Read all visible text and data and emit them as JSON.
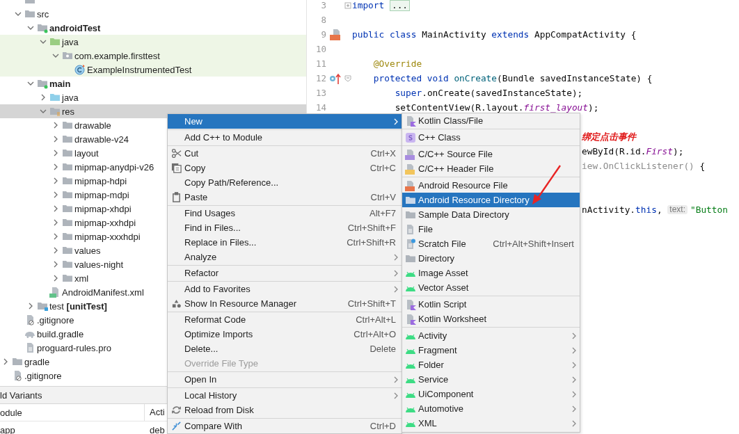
{
  "tree": {
    "items": [
      {
        "children": [
          {
            "kind": "folder",
            "selected": false,
            "highlighted": false
          },
          {
            "label": "src",
            "kind": "folder",
            "expanded": true,
            "selected": false,
            "highlighted": false,
            "children": [
              {
                "label": "androidTest",
                "kind": "module-folder",
                "expanded": true,
                "selected": false,
                "highlighted": false,
                "children": [
                  {
                    "label": "java",
                    "kind": "test-source",
                    "expanded": true,
                    "selected": false,
                    "highlighted": true,
                    "children": [
                      {
                        "label": "com.example.firsttest",
                        "kind": "package",
                        "expanded": true,
                        "selected": false,
                        "highlighted": true,
                        "children": [
                          {
                            "label": "ExampleInstrumentedTest",
                            "kind": "test-class",
                            "selected": false,
                            "highlighted": true
                          }
                        ]
                      }
                    ]
                  }
                ]
              },
              {
                "label": "main",
                "kind": "module-folder",
                "expanded": true,
                "selected": false,
                "highlighted": false,
                "children": [
                  {
                    "label": "java",
                    "kind": "source-folder",
                    "expanded": false,
                    "selected": false,
                    "highlighted": false
                  },
                  {
                    "label": "res",
                    "kind": "resource-folder",
                    "expanded": true,
                    "selected": true,
                    "highlighted": false,
                    "children": [
                      {
                        "label": "drawable",
                        "kind": "folder",
                        "expanded": false,
                        "selected": false,
                        "highlighted": false
                      },
                      {
                        "label": "drawable-v24",
                        "kind": "folder",
                        "expanded": false,
                        "selected": false,
                        "highlighted": false
                      },
                      {
                        "label": "layout",
                        "kind": "folder",
                        "expanded": false,
                        "selected": false,
                        "highlighted": false
                      },
                      {
                        "label": "mipmap-anydpi-v26",
                        "kind": "folder",
                        "expanded": false,
                        "selected": false,
                        "highlighted": false
                      },
                      {
                        "label": "mipmap-hdpi",
                        "kind": "folder",
                        "expanded": false,
                        "selected": false,
                        "highlighted": false
                      },
                      {
                        "label": "mipmap-mdpi",
                        "kind": "folder",
                        "expanded": false,
                        "selected": false,
                        "highlighted": false
                      },
                      {
                        "label": "mipmap-xhdpi",
                        "kind": "folder",
                        "expanded": false,
                        "selected": false,
                        "highlighted": false
                      },
                      {
                        "label": "mipmap-xxhdpi",
                        "kind": "folder",
                        "expanded": false,
                        "selected": false,
                        "highlighted": false
                      },
                      {
                        "label": "mipmap-xxxhdpi",
                        "kind": "folder",
                        "expanded": false,
                        "selected": false,
                        "highlighted": false
                      },
                      {
                        "label": "values",
                        "kind": "folder",
                        "expanded": false,
                        "selected": false,
                        "highlighted": false
                      },
                      {
                        "label": "values-night",
                        "kind": "folder",
                        "expanded": false,
                        "selected": false,
                        "highlighted": false
                      },
                      {
                        "label": "xml",
                        "kind": "folder",
                        "expanded": false,
                        "selected": false,
                        "highlighted": false
                      }
                    ]
                  },
                  {
                    "label": "AndroidManifest.xml",
                    "kind": "manifest",
                    "selected": false,
                    "highlighted": false
                  }
                ]
              },
              {
                "label": "test **[unitTest]**",
                "kind": "test-folder",
                "expanded": false,
                "selected": false,
                "highlighted": false
              }
            ]
          },
          {
            "label": ".gitignore",
            "kind": "ignore-file",
            "selected": false,
            "highlighted": false
          },
          {
            "label": "build.gradle",
            "kind": "gradle-file",
            "selected": false,
            "highlighted": false
          },
          {
            "label": "proguard-rules.pro",
            "kind": "text-file",
            "selected": false,
            "highlighted": false
          }
        ]
      },
      {
        "label": "gradle",
        "kind": "folder",
        "expanded": false,
        "selected": false,
        "highlighted": false
      },
      {
        "label": ".gitignore",
        "kind": "ignore-file",
        "selected": false,
        "highlighted": false
      }
    ]
  },
  "build_variants": {
    "title": "ld Variants",
    "columns": [
      "odule",
      "Acti"
    ],
    "rows": [
      [
        "app",
        "deb"
      ]
    ]
  },
  "editor": {
    "lines": [
      {
        "kind": "line",
        "number": "3",
        "fold_expanded": false,
        "segments": [
          {
            "text": "import ",
            "kind": "keyword"
          },
          {
            "text": "...",
            "kind": "folded"
          }
        ]
      },
      {
        "kind": "line",
        "number": "8"
      },
      {
        "kind": "line",
        "number": "9",
        "gutter": {
          "kind": "layout-link"
        },
        "segments": [
          {
            "text": "public class ",
            "kind": "keyword"
          },
          {
            "text": "MainActivity ",
            "kind": "plain"
          },
          {
            "text": "extends ",
            "kind": "keyword"
          },
          {
            "text": "AppCompatActivity {",
            "kind": "plain"
          }
        ]
      },
      {
        "kind": "line",
        "number": "10"
      },
      {
        "kind": "line",
        "number": "11",
        "segments": [
          {
            "text": "    @Override",
            "kind": "annotation"
          }
        ]
      },
      {
        "kind": "line",
        "number": "12",
        "gutter": {
          "kind": "override"
        },
        "fold_expanded": true,
        "segments": [
          {
            "text": "    protected void ",
            "kind": "keyword"
          },
          {
            "text": "onCreate",
            "kind": "method"
          },
          {
            "text": "(Bundle savedInstanceState) {",
            "kind": "plain"
          }
        ]
      },
      {
        "kind": "line",
        "number": "13",
        "segments": [
          {
            "text": "        super",
            "kind": "keyword"
          },
          {
            "text": ".onCreate(savedInstanceState);",
            "kind": "plain"
          }
        ]
      },
      {
        "kind": "line",
        "number": "14",
        "segments": [
          {
            "text": "        setContentView(R.layout.",
            "kind": "plain"
          },
          {
            "text": "first_layout",
            "kind": "field"
          },
          {
            "text": ");",
            "kind": "plain"
          }
        ]
      },
      {
        "kind": "hidden"
      },
      {
        "kind": "tail",
        "segments": [
          {
            "text": "绑定点击事件",
            "kind": "comment"
          }
        ]
      },
      {
        "kind": "tail",
        "segments": [
          {
            "text": "ewById(R.id.",
            "kind": "plain"
          },
          {
            "text": "First",
            "kind": "field"
          },
          {
            "text": ");",
            "kind": "plain"
          }
        ]
      },
      {
        "kind": "tail",
        "segments": [
          {
            "text": "iew.OnClickListener() ",
            "kind": "dim"
          },
          {
            "text": "{",
            "kind": "plain"
          }
        ]
      },
      {
        "kind": "hidden"
      },
      {
        "kind": "hidden"
      },
      {
        "kind": "tail",
        "segments": [
          {
            "text": "nActivity.",
            "kind": "plain"
          },
          {
            "text": "this",
            "kind": "keyword"
          },
          {
            "text": ", ",
            "kind": "plain"
          },
          {
            "text": "text:",
            "kind": "hint"
          },
          {
            "text": "\"Button",
            "kind": "string"
          }
        ]
      }
    ]
  },
  "context_menu": {
    "groups": [
      [
        {
          "label": "New",
          "kind": "plain",
          "selected": true,
          "disabled": false,
          "submenu": true
        }
      ],
      [
        {
          "label": "Add C++ to Module",
          "kind": "plain",
          "selected": false,
          "disabled": false,
          "submenu": false
        }
      ],
      [
        {
          "label": "Cut",
          "kind": "cut",
          "shortcut": "Ctrl+X",
          "selected": false,
          "disabled": false,
          "submenu": false
        },
        {
          "label": "Copy",
          "kind": "copy",
          "shortcut": "Ctrl+C",
          "selected": false,
          "disabled": false,
          "submenu": false
        },
        {
          "label": "Copy Path/Reference...",
          "kind": "plain",
          "selected": false,
          "disabled": false,
          "submenu": false
        },
        {
          "label": "Paste",
          "kind": "paste",
          "shortcut": "Ctrl+V",
          "selected": false,
          "disabled": false,
          "submenu": false
        }
      ],
      [
        {
          "label": "Find Usages",
          "kind": "plain",
          "shortcut": "Alt+F7",
          "selected": false,
          "disabled": false,
          "submenu": false
        },
        {
          "label": "Find in Files...",
          "kind": "plain",
          "shortcut": "Ctrl+Shift+F",
          "selected": false,
          "disabled": false,
          "submenu": false
        },
        {
          "label": "Replace in Files...",
          "kind": "plain",
          "shortcut": "Ctrl+Shift+R",
          "selected": false,
          "disabled": false,
          "submenu": false
        },
        {
          "label": "Analyze",
          "kind": "plain",
          "selected": false,
          "disabled": false,
          "submenu": true
        }
      ],
      [
        {
          "label": "Refactor",
          "kind": "plain",
          "selected": false,
          "disabled": false,
          "submenu": true
        }
      ],
      [
        {
          "label": "Add to Favorites",
          "kind": "plain",
          "selected": false,
          "disabled": false,
          "submenu": true
        },
        {
          "label": "Show In Resource Manager",
          "kind": "resource-manager",
          "shortcut": "Ctrl+Shift+T",
          "selected": false,
          "disabled": false,
          "submenu": false
        }
      ],
      [
        {
          "label": "Reformat Code",
          "kind": "plain",
          "shortcut": "Ctrl+Alt+L",
          "selected": false,
          "disabled": false,
          "submenu": false
        },
        {
          "label": "Optimize Imports",
          "kind": "plain",
          "shortcut": "Ctrl+Alt+O",
          "selected": false,
          "disabled": false,
          "submenu": false
        },
        {
          "label": "Delete...",
          "kind": "plain",
          "shortcut": "Delete",
          "selected": false,
          "disabled": false,
          "submenu": false
        },
        {
          "label": "Override File Type",
          "kind": "plain",
          "selected": false,
          "disabled": true,
          "submenu": false
        }
      ],
      [
        {
          "label": "Open In",
          "kind": "plain",
          "selected": false,
          "disabled": false,
          "submenu": true
        }
      ],
      [
        {
          "label": "Local History",
          "kind": "plain",
          "selected": false,
          "disabled": false,
          "submenu": true
        },
        {
          "label": "Reload from Disk",
          "kind": "reload",
          "selected": false,
          "disabled": false,
          "submenu": false
        }
      ],
      [
        {
          "label": "Compare With",
          "kind": "compare",
          "shortcut": "Ctrl+D",
          "selected": false,
          "disabled": false,
          "submenu": false
        }
      ]
    ]
  },
  "new_submenu": {
    "groups": [
      [
        {
          "label": "Kotlin Class/File",
          "kind": "kotlin-class",
          "selected": false,
          "submenu": false
        }
      ],
      [
        {
          "label": "C++ Class",
          "kind": "cpp-class",
          "selected": false,
          "submenu": false
        }
      ],
      [
        {
          "label": "C/C++ Source File",
          "kind": "c-source",
          "selected": false,
          "submenu": false
        },
        {
          "label": "C/C++ Header File",
          "kind": "c-header",
          "selected": false,
          "submenu": false
        }
      ],
      [
        {
          "label": "Android Resource File",
          "kind": "resource-file",
          "selected": false,
          "submenu": false
        },
        {
          "label": "Android Resource Directory",
          "kind": "folder",
          "selected": true,
          "submenu": false
        },
        {
          "label": "Sample Data Directory",
          "kind": "folder",
          "selected": false,
          "submenu": false
        },
        {
          "label": "File",
          "kind": "file",
          "selected": false,
          "submenu": false
        },
        {
          "label": "Scratch File",
          "kind": "scratch",
          "shortcut": "Ctrl+Alt+Shift+Insert",
          "selected": false,
          "submenu": false
        },
        {
          "label": "Directory",
          "kind": "folder",
          "selected": false,
          "submenu": false
        },
        {
          "label": "Image Asset",
          "kind": "android",
          "selected": false,
          "submenu": false
        },
        {
          "label": "Vector Asset",
          "kind": "android",
          "selected": false,
          "submenu": false
        }
      ],
      [
        {
          "label": "Kotlin Script",
          "kind": "kotlin-script",
          "selected": false,
          "submenu": false
        },
        {
          "label": "Kotlin Worksheet",
          "kind": "kotlin-script",
          "selected": false,
          "submenu": false
        }
      ],
      [
        {
          "label": "Activity",
          "kind": "android",
          "selected": false,
          "submenu": true
        },
        {
          "label": "Fragment",
          "kind": "android",
          "selected": false,
          "submenu": true
        },
        {
          "label": "Folder",
          "kind": "android",
          "selected": false,
          "submenu": true
        },
        {
          "label": "Service",
          "kind": "android",
          "selected": false,
          "submenu": true
        },
        {
          "label": "UiComponent",
          "kind": "android",
          "selected": false,
          "submenu": true
        },
        {
          "label": "Automotive",
          "kind": "android",
          "selected": false,
          "submenu": true
        },
        {
          "label": "XML",
          "kind": "android",
          "selected": false,
          "submenu": true
        }
      ]
    ]
  }
}
